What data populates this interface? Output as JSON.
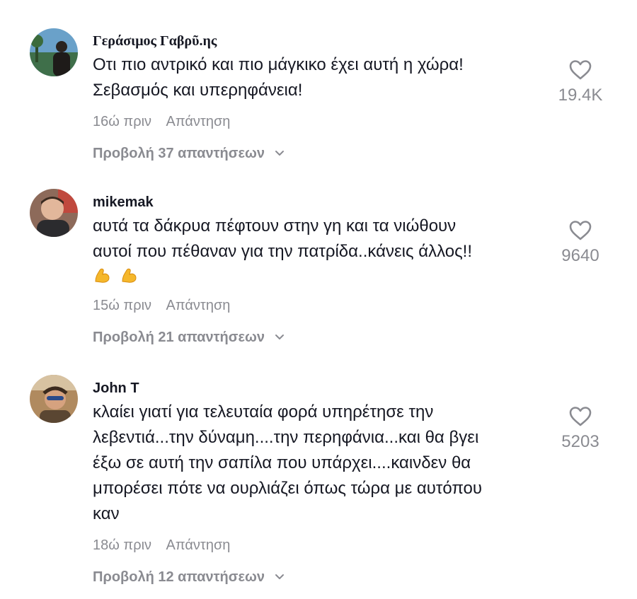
{
  "comments": [
    {
      "username": "Γεράσιμος Γαβρῦ.ης",
      "text": "Οτι πιο αντρικό και πιο μάγκικο έχει αυτή η χώρα!\nΣεβασμός και υπερηφάνεια!",
      "time": "16ώ πριν",
      "reply_label": "Απάντηση",
      "view_replies": "Προβολή 37 απαντήσεων",
      "likes": "19.4K"
    },
    {
      "username": "mikemak",
      "text": "αυτά τα δάκρυα πέφτουν στην γη και τα νιώθουν\nαυτοί που πέθαναν για την πατρίδα..κάνεις άλλος!!",
      "emojis": [
        "flexed-biceps-icon",
        "flexed-biceps-icon"
      ],
      "time": "15ώ πριν",
      "reply_label": "Απάντηση",
      "view_replies": "Προβολή 21 απαντήσεων",
      "likes": "9640"
    },
    {
      "username": "John T",
      "text": "κλαίει γιατί για τελευταία φορά υπηρέτησε την\nλεβεντιά...την δύναμη....την περηφάνια...και θα βγει\nέξω σε αυτή την σαπίλα που υπάρχει....καινδεν θα\nμπορέσει πότε να ουρλιάζει όπως τώρα με αυτόπου\nκαν",
      "time": "18ώ πριν",
      "reply_label": "Απάντηση",
      "view_replies": "Προβολή 12 απαντήσεων",
      "likes": "5203"
    }
  ],
  "colors": {
    "text": "#161823",
    "muted": "#8a8b91",
    "emoji": "#f5b72b"
  }
}
